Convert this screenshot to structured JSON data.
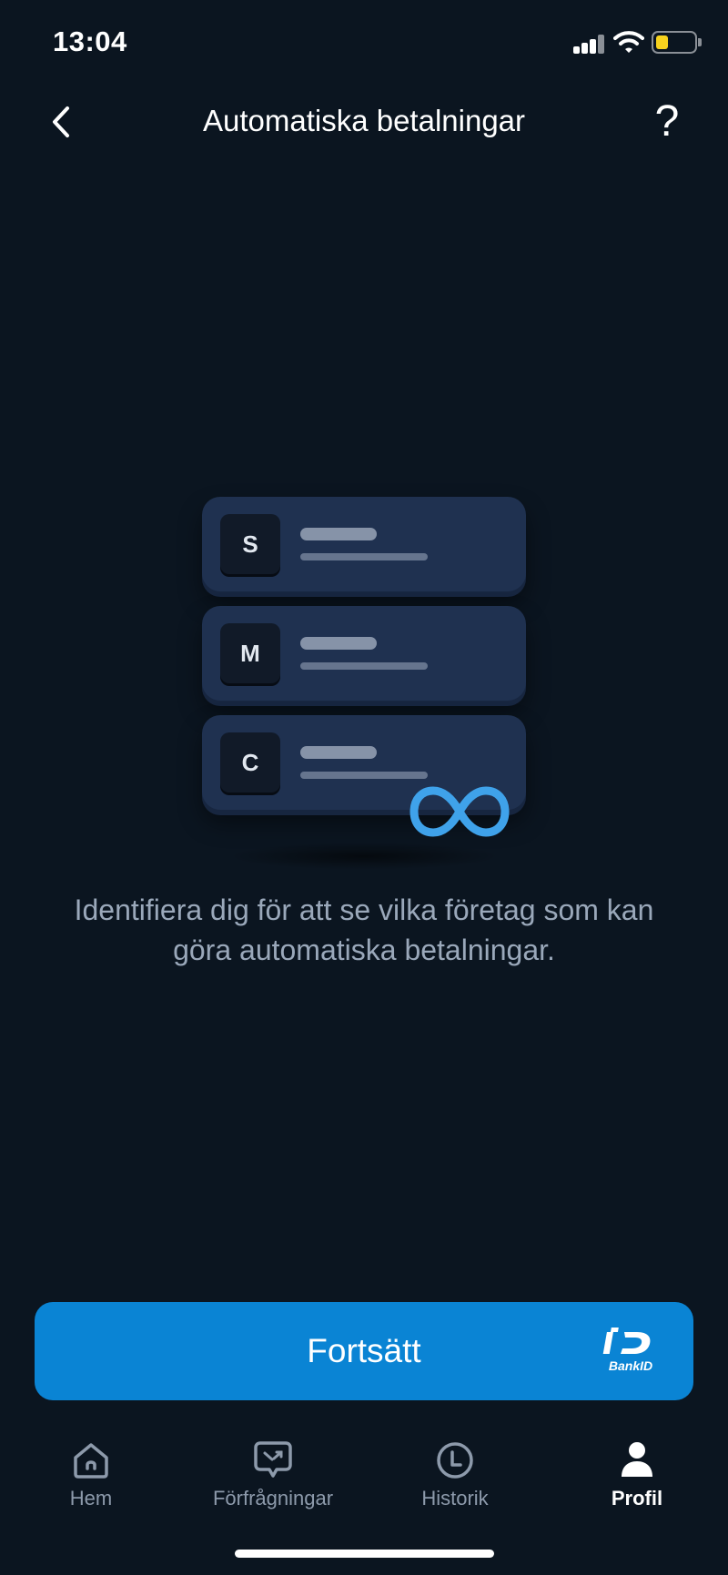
{
  "status_bar": {
    "time": "13:04",
    "icons": [
      "signal-icon",
      "wifi-icon",
      "battery-icon"
    ],
    "battery_color": "#f7d21e"
  },
  "header": {
    "back_icon": "chevron-left-icon",
    "title": "Automatiska betalningar",
    "help_label": "?"
  },
  "illustration": {
    "cards": [
      {
        "letter": "S"
      },
      {
        "letter": "M"
      },
      {
        "letter": "C"
      }
    ],
    "badge_icon": "infinity-icon",
    "badge_color": "#3fa2ea"
  },
  "main": {
    "description": "Identifiera dig för att se vilka företag som kan göra automatiska betalningar."
  },
  "continue_button": {
    "label": "Fortsätt",
    "icon": "bankid-icon",
    "bankid_text": "BankID",
    "color": "#0a84d4"
  },
  "tab_bar": {
    "tabs": [
      {
        "label": "Hem",
        "icon": "home-icon",
        "active": false
      },
      {
        "label": "Förfrågningar",
        "icon": "requests-icon",
        "active": false
      },
      {
        "label": "Historik",
        "icon": "history-icon",
        "active": false
      },
      {
        "label": "Profil",
        "icon": "profile-icon",
        "active": true
      }
    ]
  }
}
